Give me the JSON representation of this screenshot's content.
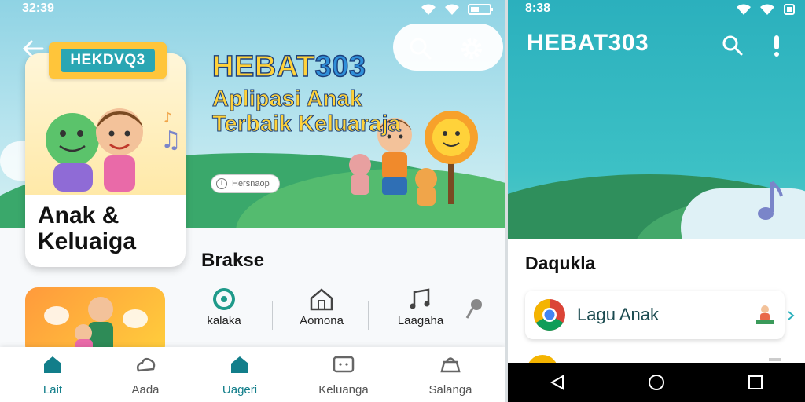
{
  "left": {
    "status_time": "32:39",
    "hero": {
      "title_main": "HEBAT",
      "title_num": "303",
      "subtitle": "Aplipasi Anak Terbaik Keluaraja",
      "pill_label": "Hersnaop"
    },
    "card": {
      "ribbon": "HEKDVQ3",
      "title": "Anak & Keluaiga"
    },
    "section_title": "Brakse",
    "categories": [
      {
        "label": "kalaka",
        "icon": "target-icon"
      },
      {
        "label": "Aomona",
        "icon": "house-icon"
      },
      {
        "label": "Laagaha",
        "icon": "music-notes-icon"
      }
    ],
    "bottom_nav": [
      {
        "label": "Lait",
        "icon": "home-icon",
        "active": true
      },
      {
        "label": "Aada",
        "icon": "cloud-icon",
        "active": false
      },
      {
        "label": "Uageri",
        "icon": "home-icon",
        "active": true
      },
      {
        "label": "Keluanga",
        "icon": "tv-icon",
        "active": false
      },
      {
        "label": "Salanga",
        "icon": "bag-icon",
        "active": false
      }
    ]
  },
  "right": {
    "status_time": "8:38",
    "title": "HEBAT303",
    "section_title": "Daqukla",
    "list": [
      {
        "label": "Lagu Anak",
        "icon": "chrome-icon"
      }
    ]
  },
  "colors": {
    "teal": "#2bb0bd",
    "accent_yellow": "#ffd23a",
    "nav_active": "#127e8a"
  }
}
